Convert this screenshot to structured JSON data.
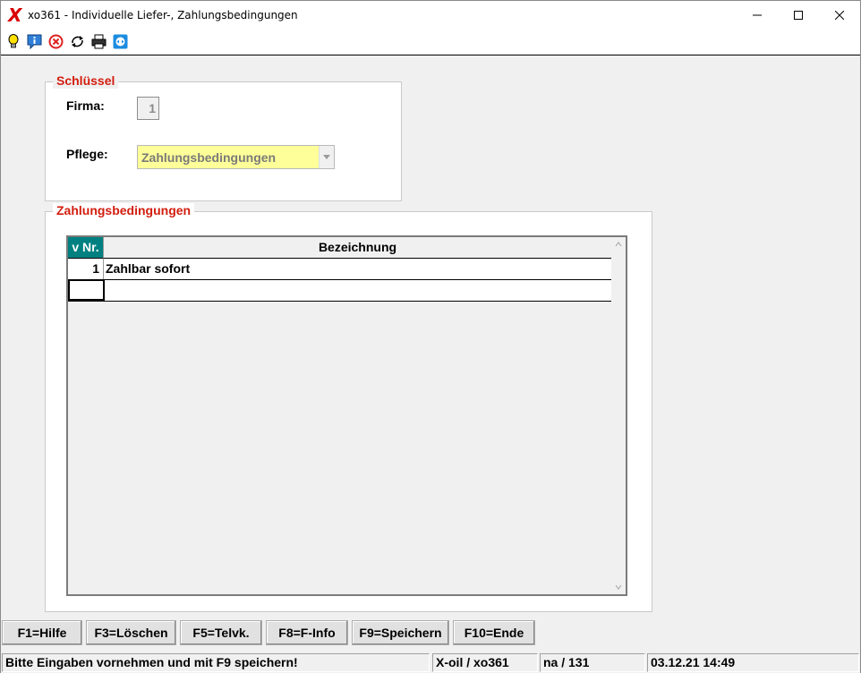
{
  "window": {
    "title": "xo361 - Individuelle Liefer-, Zahlungsbedingungen",
    "app_icon_glyph": "X",
    "controls": [
      "minimize-icon",
      "maximize-icon",
      "close-icon"
    ]
  },
  "toolbar": {
    "icons": [
      "lightbulb-icon",
      "info-icon",
      "cancel-icon",
      "refresh-icon",
      "print-icon",
      "remote-icon"
    ]
  },
  "schluessel": {
    "title": "Schlüssel",
    "firma_label": "Firma:",
    "firma_value": "1",
    "pflege_label": "Pflege:",
    "pflege_value": "Zahlungsbedingungen"
  },
  "zahlung": {
    "title": "Zahlungsbedingungen",
    "columns": [
      "v Nr.",
      "Bezeichnung"
    ],
    "rows": [
      {
        "nr": "1",
        "bezeichnung": "Zahlbar sofort"
      },
      {
        "nr": "",
        "bezeichnung": ""
      }
    ]
  },
  "function_keys": [
    "F1=Hilfe",
    "F3=Löschen",
    "F5=Telvk.",
    "F8=F-Info",
    "F9=Speichern",
    "F10=Ende"
  ],
  "status": {
    "message": "Bitte Eingaben vornehmen und mit F9 speichern!",
    "app": "X-oil / xo361",
    "user": "na / 131",
    "datetime": "03.12.21 14:49"
  },
  "colors": {
    "accent_red": "#d21d0e",
    "header_teal": "#008080",
    "select_yellow": "#ffff99"
  }
}
